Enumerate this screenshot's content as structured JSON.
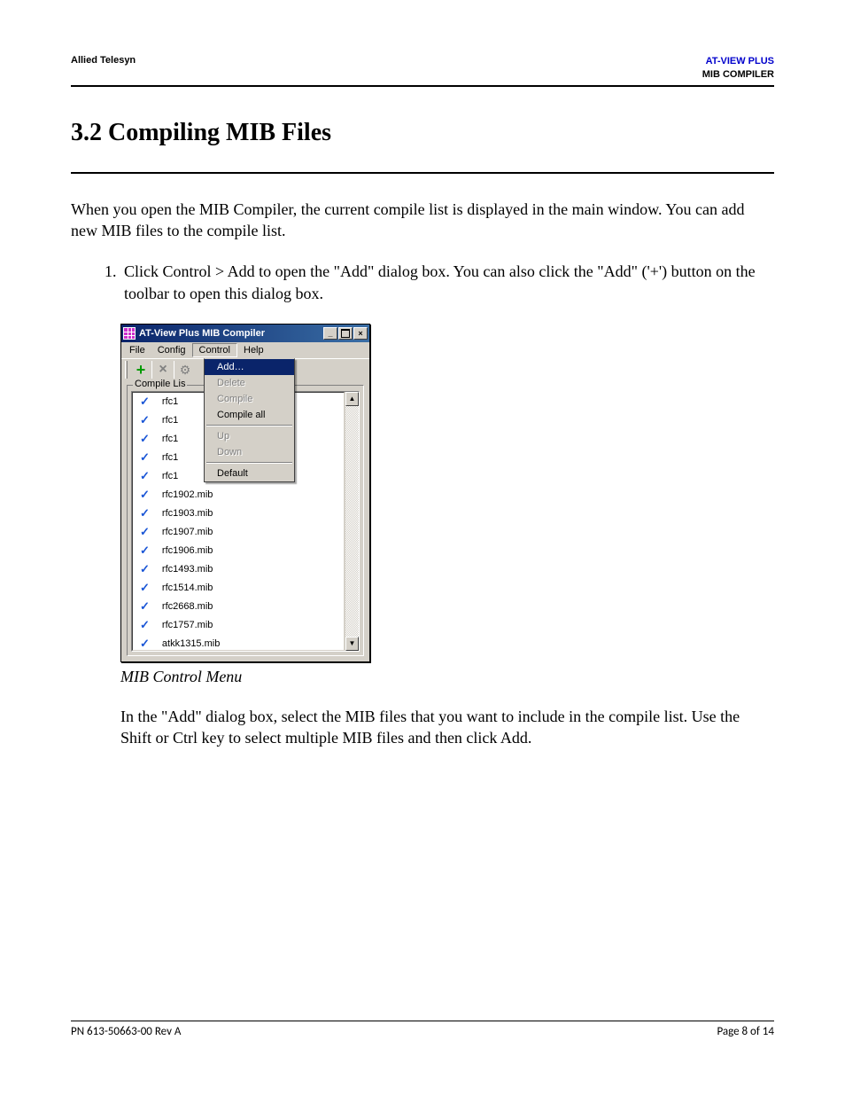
{
  "header": {
    "left": "Allied Telesyn",
    "right_line1": "AT-VIEW PLUS",
    "right_line2": "MIB COMPILER"
  },
  "section_title": "3.2 Compiling MIB Files",
  "intro": "When you open the MIB Compiler, the current compile list is displayed in the main window. You can add new MIB files to the compile list.",
  "step1": "Click Control > Add to open the \"Add\" dialog box. You can also click the \"Add\" ('+') button on the toolbar to open this dialog box.",
  "window": {
    "title": "AT-View Plus MIB Compiler",
    "menus": {
      "file": "File",
      "config": "Config",
      "control": "Control",
      "help": "Help"
    },
    "dropdown": {
      "add": "Add…",
      "delete": "Delete",
      "compile": "Compile",
      "compile_all": "Compile all",
      "up": "Up",
      "down": "Down",
      "default": "Default"
    },
    "group_label": "Compile Lis",
    "items_visible": [
      "rfc1",
      "rfc1",
      "rfc1",
      "rfc1",
      "rfc1"
    ],
    "items": [
      "rfc1902.mib",
      "rfc1903.mib",
      "rfc1907.mib",
      "rfc1906.mib",
      "rfc1493.mib",
      "rfc1514.mib",
      "rfc2668.mib",
      "rfc1757.mib",
      "atkk1315.mib"
    ]
  },
  "caption": "MIB Control Menu",
  "after": "In the \"Add\" dialog box, select the MIB files that you want to include in the compile list. Use the Shift or Ctrl key to select multiple MIB files and then click Add.",
  "footer": {
    "left": "PN 613-50663-00 Rev A",
    "right": "Page 8 of 14"
  }
}
